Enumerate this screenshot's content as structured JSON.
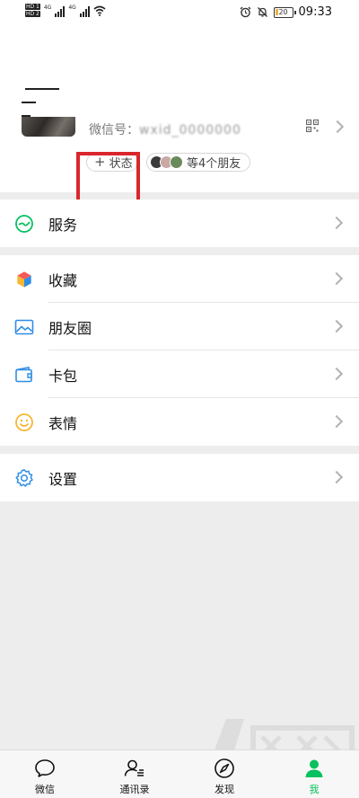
{
  "status_bar": {
    "sim1": "HD 1",
    "sim2": "HD 2",
    "net1": "4G",
    "net2": "4G",
    "battery": "20",
    "battery_level": 0.2,
    "time": "09:33"
  },
  "profile": {
    "wechat_id_label": "微信号：",
    "wechat_id_value": "wxid_0000000",
    "status_button": "状态",
    "friends_text": "等4个朋友"
  },
  "menu": {
    "services": "服务",
    "favorites": "收藏",
    "moments": "朋友圈",
    "cards": "卡包",
    "stickers": "表情",
    "settings": "设置"
  },
  "tabbar": {
    "tabs": [
      {
        "label": "微信",
        "icon": "chat-icon"
      },
      {
        "label": "通讯录",
        "icon": "contacts-icon"
      },
      {
        "label": "发现",
        "icon": "compass-icon"
      },
      {
        "label": "我",
        "icon": "person-icon",
        "active": true
      }
    ]
  },
  "colors": {
    "accent": "#07c160",
    "highlight": "#d9262b",
    "background": "#ededed"
  }
}
